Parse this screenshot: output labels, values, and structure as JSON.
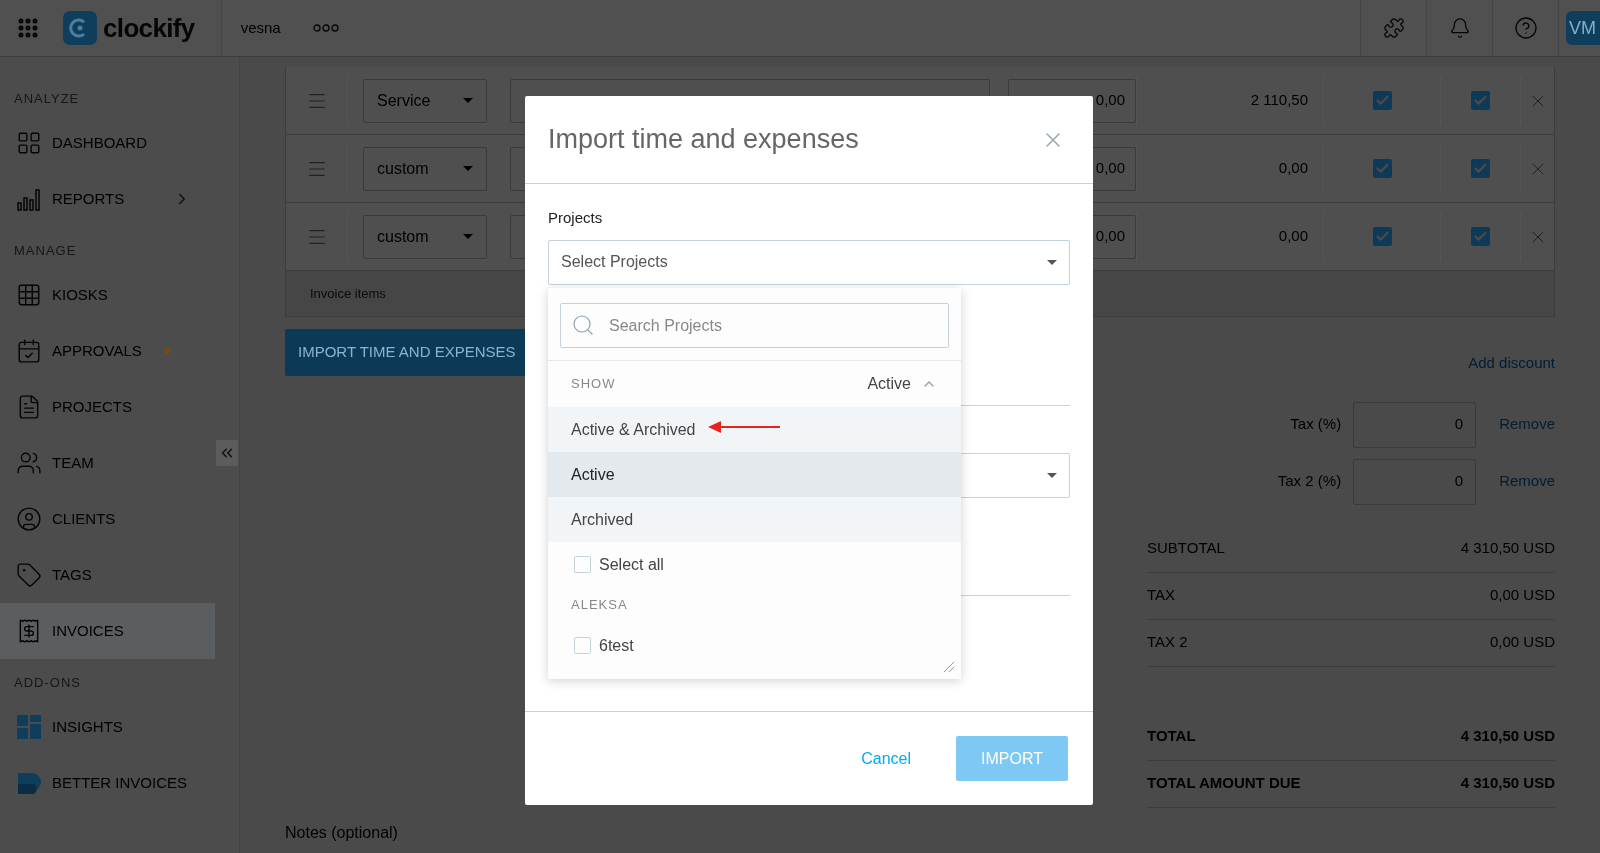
{
  "top_bar": {
    "logo_text": "clockify",
    "workspace": "vesna",
    "avatar": "VM"
  },
  "sidebar": {
    "sections": [
      {
        "title": "ANALYZE",
        "items": [
          {
            "label": "DASHBOARD",
            "selected": false,
            "expandable": false,
            "notification": false
          },
          {
            "label": "REPORTS",
            "selected": false,
            "expandable": true,
            "notification": false
          }
        ]
      },
      {
        "title": "MANAGE",
        "items": [
          {
            "label": "KIOSKS",
            "selected": false,
            "expandable": false,
            "notification": false
          },
          {
            "label": "APPROVALS",
            "selected": false,
            "expandable": false,
            "notification": true
          },
          {
            "label": "PROJECTS",
            "selected": false,
            "expandable": false,
            "notification": false
          },
          {
            "label": "TEAM",
            "selected": false,
            "expandable": false,
            "notification": false
          },
          {
            "label": "CLIENTS",
            "selected": false,
            "expandable": false,
            "notification": false
          },
          {
            "label": "TAGS",
            "selected": false,
            "expandable": false,
            "notification": false
          },
          {
            "label": "INVOICES",
            "selected": true,
            "expandable": false,
            "notification": false
          }
        ]
      },
      {
        "title": "ADD-ONS",
        "items": [
          {
            "label": "INSIGHTS",
            "selected": false,
            "expandable": false,
            "notification": false
          },
          {
            "label": "BETTER INVOICES",
            "selected": false,
            "expandable": false,
            "notification": false
          }
        ]
      }
    ]
  },
  "invoice_items": {
    "rows": [
      {
        "type": "Service",
        "rate": "0,00",
        "amount": "2 110,50",
        "tax": true,
        "tax2": true
      },
      {
        "type": "custom",
        "rate": "0,00",
        "amount": "0,00",
        "tax": true,
        "tax2": true
      },
      {
        "type": "custom",
        "rate": "0,00",
        "amount": "0,00",
        "tax": true,
        "tax2": true
      }
    ],
    "footer": "Invoice items"
  },
  "import_button": "IMPORT TIME AND EXPENSES",
  "summary": {
    "add_discount": "Add discount",
    "taxes": [
      {
        "label": "Tax (%)",
        "value": "0",
        "action": "Remove"
      },
      {
        "label": "Tax 2 (%)",
        "value": "0",
        "action": "Remove"
      }
    ],
    "totals": [
      {
        "label": "SUBTOTAL",
        "value": "4 310,50 USD",
        "emphasis": false
      },
      {
        "label": "TAX",
        "value": "0,00 USD",
        "emphasis": false
      },
      {
        "label": "TAX 2",
        "value": "0,00 USD",
        "emphasis": false
      },
      {
        "label": "TOTAL",
        "value": "4 310,50 USD",
        "emphasis": true
      },
      {
        "label": "TOTAL AMOUNT DUE",
        "value": "4 310,50 USD",
        "emphasis": true
      }
    ]
  },
  "notes_label": "Notes (optional)",
  "modal": {
    "title": "Import time and expenses",
    "projects_label": "Projects",
    "projects_placeholder": "Select Projects",
    "dropdown": {
      "search_placeholder": "Search Projects",
      "show_label": "SHOW",
      "show_value": "Active",
      "options": [
        {
          "label": "Active & Archived",
          "selected": false
        },
        {
          "label": "Active",
          "selected": true
        },
        {
          "label": "Archived",
          "selected": false
        }
      ],
      "select_all": {
        "label": "Select all",
        "checked": false
      },
      "groups": [
        {
          "name": "ALEKSA",
          "projects": [
            {
              "name": "6test",
              "checked": false
            }
          ]
        }
      ]
    },
    "cancel": "Cancel",
    "import": {
      "label": "IMPORT",
      "disabled": true
    }
  }
}
